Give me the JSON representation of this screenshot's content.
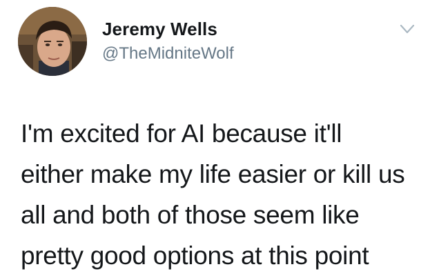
{
  "tweet": {
    "author": {
      "display_name": "Jeremy Wells",
      "handle": "@TheMidniteWolf"
    },
    "menu_icon": "chevron-down-icon",
    "text_lines": [
      "I'm excited for AI because it'll",
      "either make my life easier or kill us",
      "all and both of those seem like",
      "pretty good options at this point"
    ]
  },
  "colors": {
    "text": "#14171a",
    "secondary_text": "#657786",
    "background": "#ffffff"
  }
}
